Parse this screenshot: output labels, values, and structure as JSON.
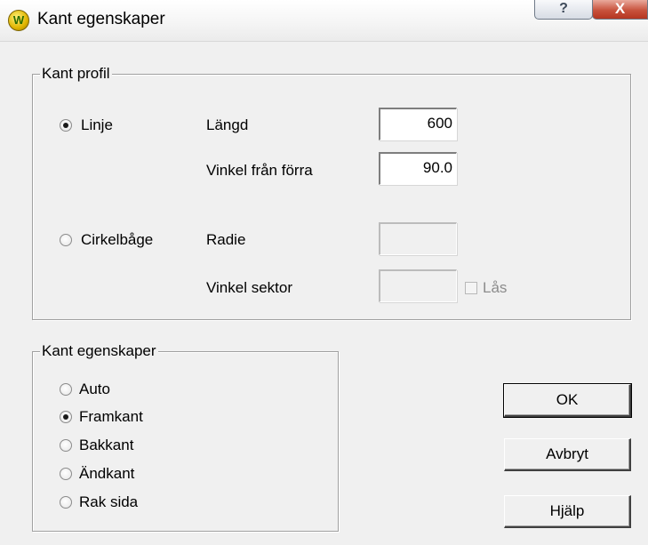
{
  "window": {
    "title": "Kant egenskaper",
    "app_icon_letter": "W",
    "help_glyph": "?",
    "close_glyph": "X"
  },
  "profile": {
    "legend": "Kant profil",
    "linje": {
      "label": "Linje",
      "checked": true
    },
    "cirkelbage": {
      "label": "Cirkelbåge",
      "checked": false
    },
    "langd": {
      "label": "Längd",
      "value": "600"
    },
    "vinkel_forra": {
      "label": "Vinkel från förra",
      "value": "90.0"
    },
    "radie": {
      "label": "Radie",
      "value": ""
    },
    "vinkel_sektor": {
      "label": "Vinkel sektor",
      "value": ""
    },
    "las": {
      "label": "Lås",
      "checked": false
    }
  },
  "properties": {
    "legend": "Kant egenskaper",
    "options": [
      {
        "label": "Auto",
        "checked": false
      },
      {
        "label": "Framkant",
        "checked": true
      },
      {
        "label": "Bakkant",
        "checked": false
      },
      {
        "label": "Ändkant",
        "checked": false
      },
      {
        "label": "Rak sida",
        "checked": false
      }
    ]
  },
  "buttons": {
    "ok": "OK",
    "cancel": "Avbryt",
    "help": "Hjälp"
  }
}
